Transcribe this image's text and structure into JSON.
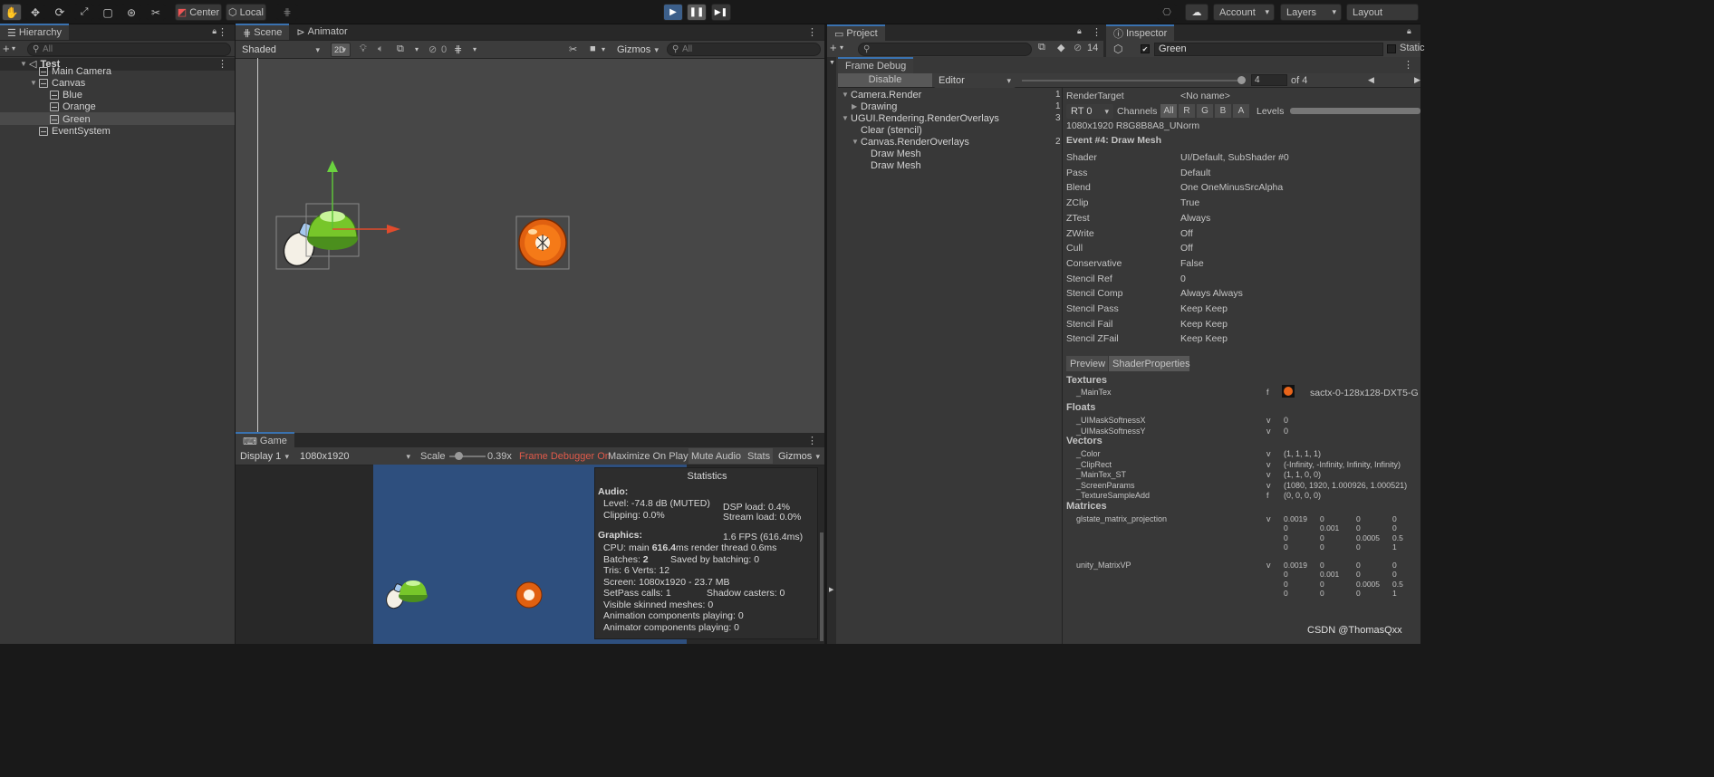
{
  "toolbar": {
    "center": "Center",
    "local": "Local",
    "account": "Account",
    "layers": "Layers",
    "layout": "Layout"
  },
  "hierarchy": {
    "tab": "Hierarchy",
    "search": "All",
    "items": [
      {
        "label": "Test"
      },
      {
        "label": "Main Camera"
      },
      {
        "label": "Canvas"
      },
      {
        "label": "Blue"
      },
      {
        "label": "Orange"
      },
      {
        "label": "Green"
      },
      {
        "label": "EventSystem"
      }
    ]
  },
  "scene": {
    "tab_scene": "Scene",
    "tab_animator": "Animator",
    "shading": "Shaded",
    "mode2d": "2D",
    "hidden_count": "0",
    "gizmos": "Gizmos",
    "search": "All"
  },
  "game": {
    "tab": "Game",
    "display": "Display 1",
    "resolution": "1080x1920",
    "scale_label": "Scale",
    "scale_value": "0.39x",
    "frame_debugger": "Frame Debugger On",
    "maximize": "Maximize On Play",
    "mute": "Mute Audio",
    "stats": "Stats",
    "gizmos": "Gizmos"
  },
  "statistics": {
    "title": "Statistics",
    "audio_header": "Audio:",
    "level": "Level: -74.8 dB (MUTED)",
    "clipping": "Clipping: 0.0%",
    "dsp": "DSP load: 0.4%",
    "stream": "Stream load: 0.0%",
    "graphics_header": "Graphics:",
    "fps": "1.6 FPS (616.4ms)",
    "cpu_prefix": "CPU: main ",
    "cpu_main": "616.4",
    "cpu_suffix": "ms  render thread 0.6ms",
    "batches_prefix": "Batches: ",
    "batches": "2",
    "saved": "Saved by batching: 0",
    "tris": "Tris: 6   Verts: 12",
    "screen": "Screen: 1080x1920 - 23.7 MB",
    "setpass": "SetPass calls: 1",
    "shadow": "Shadow casters: 0",
    "skinned": "Visible skinned meshes: 0",
    "anim": "Animation components playing: 0",
    "animator": "Animator components playing: 0"
  },
  "project": {
    "tab_project": "Project",
    "tab_inspector": "Inspector",
    "hidden_count": "14",
    "object_name": "Green",
    "static_label": "Static"
  },
  "frame_debug": {
    "tab": "Frame Debug",
    "disable": "Disable",
    "target": "Editor",
    "event_index": "4",
    "event_of": "of 4",
    "tree": [
      {
        "label": "Camera.Render",
        "count": "1"
      },
      {
        "label": "Drawing",
        "count": "1"
      },
      {
        "label": "UGUI.Rendering.RenderOverlays",
        "count": "3"
      },
      {
        "label": "Clear (stencil)",
        "count": ""
      },
      {
        "label": "Canvas.RenderOverlays",
        "count": "2"
      },
      {
        "label": "Draw Mesh",
        "count": ""
      },
      {
        "label": "Draw Mesh",
        "count": ""
      }
    ],
    "render_target_label": "RenderTarget",
    "render_target_value": "<No name>",
    "rt": "RT 0",
    "channels": "Channels",
    "ch_all": "All",
    "ch_r": "R",
    "ch_g": "G",
    "ch_b": "B",
    "ch_a": "A",
    "levels": "Levels",
    "format": "1080x1920 R8G8B8A8_UNorm",
    "event_title": "Event #4: Draw Mesh",
    "props": [
      {
        "k": "Shader",
        "v": "UI/Default, SubShader #0"
      },
      {
        "k": "Pass",
        "v": "Default"
      },
      {
        "k": "Blend",
        "v": "One OneMinusSrcAlpha"
      },
      {
        "k": "ZClip",
        "v": "True"
      },
      {
        "k": "ZTest",
        "v": "Always"
      },
      {
        "k": "ZWrite",
        "v": "Off"
      },
      {
        "k": "Cull",
        "v": "Off"
      },
      {
        "k": "Conservative",
        "v": "False"
      },
      {
        "k": "Stencil Ref",
        "v": "0"
      },
      {
        "k": "Stencil Comp",
        "v": "Always Always"
      },
      {
        "k": "Stencil Pass",
        "v": "Keep Keep"
      },
      {
        "k": "Stencil Fail",
        "v": "Keep Keep"
      },
      {
        "k": "Stencil ZFail",
        "v": "Keep Keep"
      }
    ],
    "tab_preview": "Preview",
    "tab_shaderprops": "ShaderProperties",
    "textures_header": "Textures",
    "maintex": "_MainTex",
    "maintex_stage": "f",
    "maintex_value": "sactx-0-128x128-DXT5-G",
    "floats_header": "Floats",
    "floats": [
      {
        "k": "_UIMaskSoftnessX",
        "s": "v",
        "v": "0"
      },
      {
        "k": "_UIMaskSoftnessY",
        "s": "v",
        "v": "0"
      }
    ],
    "vectors_header": "Vectors",
    "vectors": [
      {
        "k": "_Color",
        "s": "v",
        "v": "(1, 1, 1, 1)"
      },
      {
        "k": "_ClipRect",
        "s": "v",
        "v": "(-Infinity, -Infinity, Infinity, Infinity)"
      },
      {
        "k": "_MainTex_ST",
        "s": "v",
        "v": "(1, 1, 0, 0)"
      },
      {
        "k": "_ScreenParams",
        "s": "v",
        "v": "(1080, 1920, 1.000926, 1.000521)"
      },
      {
        "k": "_TextureSampleAdd",
        "s": "f",
        "v": "(0, 0, 0, 0)"
      }
    ],
    "matrices_header": "Matrices",
    "matrices": [
      {
        "k": "glstate_matrix_projection",
        "s": "v",
        "rows": [
          [
            "0.0019",
            "0",
            "0",
            "0"
          ],
          [
            "0",
            "0.001",
            "0",
            "0"
          ],
          [
            "0",
            "0",
            "0.0005",
            "0.5"
          ],
          [
            "0",
            "0",
            "0",
            "1"
          ]
        ]
      },
      {
        "k": "unity_MatrixVP",
        "s": "v",
        "rows": [
          [
            "0.0019",
            "0",
            "0",
            "0"
          ],
          [
            "0",
            "0.001",
            "0",
            "0"
          ],
          [
            "0",
            "0",
            "0.0005",
            "0.5"
          ],
          [
            "0",
            "0",
            "0",
            "1"
          ]
        ]
      }
    ]
  },
  "watermark": "CSDN @ThomasQxx"
}
